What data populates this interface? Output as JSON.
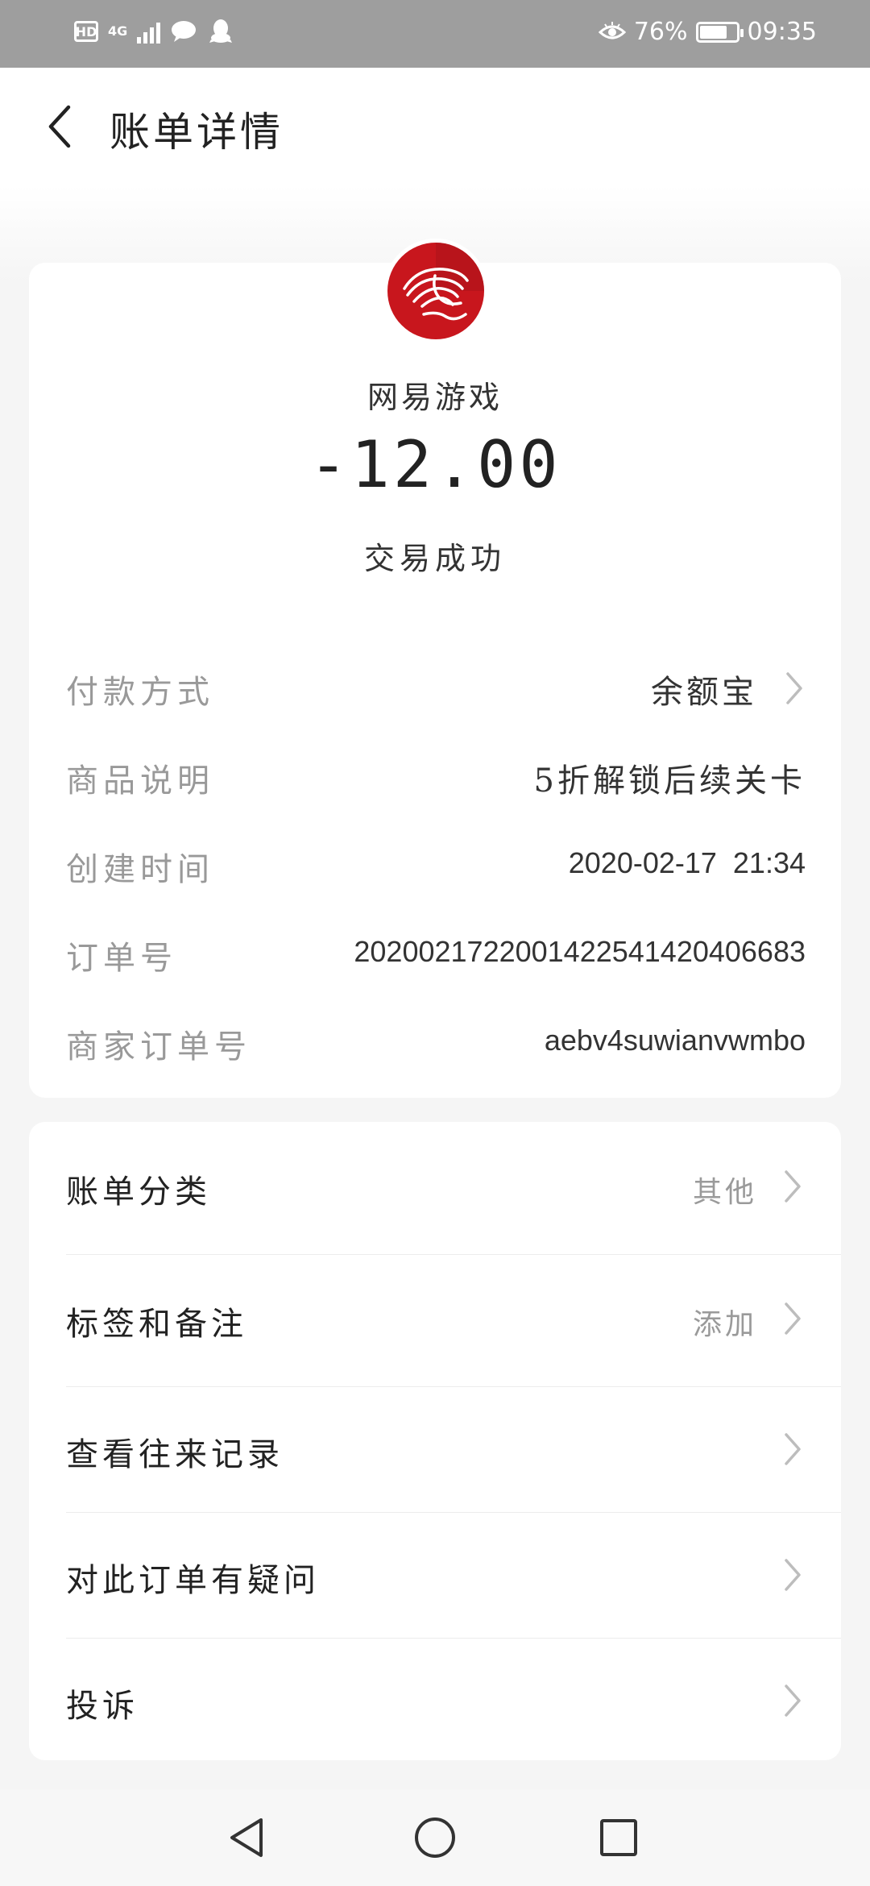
{
  "status_bar": {
    "hd": "HD",
    "network": "4G",
    "battery_percent": "76%",
    "battery_level": 0.76,
    "time": "09:35",
    "icons": [
      "hd-icon",
      "signal-icon",
      "message-icon",
      "qq-icon",
      "eye-icon",
      "battery-icon"
    ]
  },
  "header": {
    "title": "账单详情",
    "back_icon": "chevron-left-icon"
  },
  "transaction": {
    "merchant": "网易游戏",
    "merchant_logo_icon": "netease-games-logo-icon",
    "amount": "-12.00",
    "status": "交易成功"
  },
  "details": [
    {
      "label": "付款方式",
      "value": "余额宝",
      "has_chevron": true
    },
    {
      "label": "商品说明",
      "value": "5折解锁后续关卡",
      "has_chevron": false
    },
    {
      "label": "创建时间",
      "value": "2020-02-17  21:34",
      "has_chevron": false
    },
    {
      "label": "订单号",
      "value": "2020021722001422541420406683",
      "has_chevron": false
    },
    {
      "label": "商家订单号",
      "value": "aebv4suwianvwmbo",
      "has_chevron": false
    }
  ],
  "menu": [
    {
      "label": "账单分类",
      "value": "其他"
    },
    {
      "label": "标签和备注",
      "value": "添加"
    },
    {
      "label": "查看往来记录",
      "value": ""
    },
    {
      "label": "对此订单有疑问",
      "value": ""
    },
    {
      "label": "投诉",
      "value": ""
    }
  ],
  "nav": {
    "icons": [
      "back-triangle-icon",
      "home-circle-icon",
      "recent-square-icon"
    ]
  },
  "colors": {
    "status_bar_bg": "#9e9e9e",
    "logo_red": "#c8161d",
    "page_bg": "#f5f5f5",
    "label_gray": "#999999"
  }
}
